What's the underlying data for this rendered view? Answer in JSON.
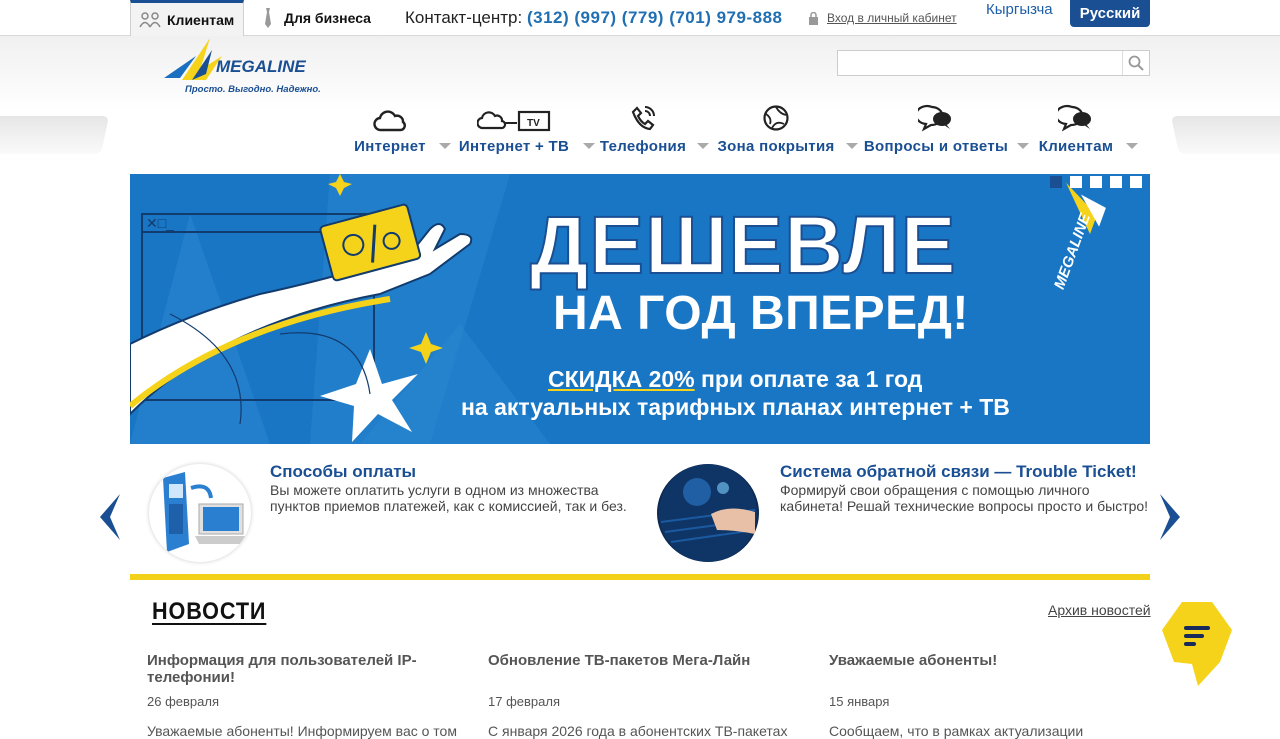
{
  "topbar": {
    "tab_clients": "Клиентам",
    "tab_business": "Для бизнеса",
    "contact_label": "Контакт-центр:",
    "contact_phones": "(312) (997) (779) (701) 979-888",
    "login_label": "Вход в личный кабинет",
    "lang_ky": "Кыргызча",
    "lang_ru": "Русский"
  },
  "brand": {
    "name": "MEGALINE",
    "tagline": "Просто. Выгодно. Надежно."
  },
  "nav": {
    "items": [
      {
        "label": "Интернет",
        "icon": "cloud-icon"
      },
      {
        "label": "Интернет + ТВ",
        "icon": "cloud-tv-icon"
      },
      {
        "label": "Телефония",
        "icon": "phone-icon"
      },
      {
        "label": "Зона покрытия",
        "icon": "globe-icon"
      },
      {
        "label": "Вопросы и ответы",
        "icon": "chat-bubbles-icon"
      },
      {
        "label": "Клиентам",
        "icon": "chat-bubbles-icon"
      }
    ]
  },
  "banner": {
    "line1": "ДЕШЕВЛЕ",
    "line2": "НА ГОД ВПЕРЕД!",
    "discount": "СКИДКА 20%",
    "line3_rest": " при оплате за 1 год",
    "line4": "на актуальных тарифных планах интернет + ТВ",
    "side_logo": "MEGALINE",
    "slides_total": 5,
    "slide_active": 1
  },
  "promos": [
    {
      "title": "Способы оплаты",
      "text1": "Вы можете оплатить услуги в одном из множества",
      "text2": "пунктов приемов платежей, как с комиссией, так и без."
    },
    {
      "title": "Система обратной связи — Trouble Ticket!",
      "text1": "Формируй свои обращения с помощью личного",
      "text2": "кабинета! Решай технические вопросы просто и быстро!"
    }
  ],
  "news": {
    "heading": "НОВОСТИ",
    "archive_label": "Архив новостей",
    "items": [
      {
        "title": "Информация для пользователей IP-телефонии!",
        "date": "26 февраля",
        "body": "Уважаемые абоненты! Информируем вас о том"
      },
      {
        "title": "Обновление ТВ-пакетов Мега-Лайн",
        "date": "17 февраля",
        "body": "С января 2026 года в абонентских ТВ-пакетах"
      },
      {
        "title": "Уважаемые абоненты!",
        "date": "15 января",
        "body": "Сообщаем, что в рамках актуализации"
      }
    ]
  },
  "colors": {
    "brand_blue": "#1a4f93",
    "link_blue": "#1f6fb2",
    "accent_yellow": "#f3d11b",
    "banner_blue": "#1976c4"
  }
}
